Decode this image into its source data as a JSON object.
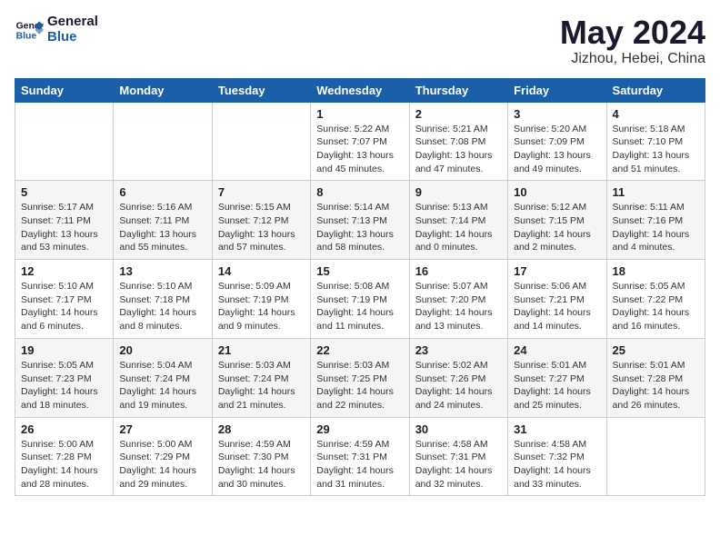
{
  "logo": {
    "line1": "General",
    "line2": "Blue"
  },
  "title": "May 2024",
  "location": "Jizhou, Hebei, China",
  "days_of_week": [
    "Sunday",
    "Monday",
    "Tuesday",
    "Wednesday",
    "Thursday",
    "Friday",
    "Saturday"
  ],
  "weeks": [
    [
      {
        "day": "",
        "info": []
      },
      {
        "day": "",
        "info": []
      },
      {
        "day": "",
        "info": []
      },
      {
        "day": "1",
        "info": [
          "Sunrise: 5:22 AM",
          "Sunset: 7:07 PM",
          "Daylight: 13 hours",
          "and 45 minutes."
        ]
      },
      {
        "day": "2",
        "info": [
          "Sunrise: 5:21 AM",
          "Sunset: 7:08 PM",
          "Daylight: 13 hours",
          "and 47 minutes."
        ]
      },
      {
        "day": "3",
        "info": [
          "Sunrise: 5:20 AM",
          "Sunset: 7:09 PM",
          "Daylight: 13 hours",
          "and 49 minutes."
        ]
      },
      {
        "day": "4",
        "info": [
          "Sunrise: 5:18 AM",
          "Sunset: 7:10 PM",
          "Daylight: 13 hours",
          "and 51 minutes."
        ]
      }
    ],
    [
      {
        "day": "5",
        "info": [
          "Sunrise: 5:17 AM",
          "Sunset: 7:11 PM",
          "Daylight: 13 hours",
          "and 53 minutes."
        ]
      },
      {
        "day": "6",
        "info": [
          "Sunrise: 5:16 AM",
          "Sunset: 7:11 PM",
          "Daylight: 13 hours",
          "and 55 minutes."
        ]
      },
      {
        "day": "7",
        "info": [
          "Sunrise: 5:15 AM",
          "Sunset: 7:12 PM",
          "Daylight: 13 hours",
          "and 57 minutes."
        ]
      },
      {
        "day": "8",
        "info": [
          "Sunrise: 5:14 AM",
          "Sunset: 7:13 PM",
          "Daylight: 13 hours",
          "and 58 minutes."
        ]
      },
      {
        "day": "9",
        "info": [
          "Sunrise: 5:13 AM",
          "Sunset: 7:14 PM",
          "Daylight: 14 hours",
          "and 0 minutes."
        ]
      },
      {
        "day": "10",
        "info": [
          "Sunrise: 5:12 AM",
          "Sunset: 7:15 PM",
          "Daylight: 14 hours",
          "and 2 minutes."
        ]
      },
      {
        "day": "11",
        "info": [
          "Sunrise: 5:11 AM",
          "Sunset: 7:16 PM",
          "Daylight: 14 hours",
          "and 4 minutes."
        ]
      }
    ],
    [
      {
        "day": "12",
        "info": [
          "Sunrise: 5:10 AM",
          "Sunset: 7:17 PM",
          "Daylight: 14 hours",
          "and 6 minutes."
        ]
      },
      {
        "day": "13",
        "info": [
          "Sunrise: 5:10 AM",
          "Sunset: 7:18 PM",
          "Daylight: 14 hours",
          "and 8 minutes."
        ]
      },
      {
        "day": "14",
        "info": [
          "Sunrise: 5:09 AM",
          "Sunset: 7:19 PM",
          "Daylight: 14 hours",
          "and 9 minutes."
        ]
      },
      {
        "day": "15",
        "info": [
          "Sunrise: 5:08 AM",
          "Sunset: 7:19 PM",
          "Daylight: 14 hours",
          "and 11 minutes."
        ]
      },
      {
        "day": "16",
        "info": [
          "Sunrise: 5:07 AM",
          "Sunset: 7:20 PM",
          "Daylight: 14 hours",
          "and 13 minutes."
        ]
      },
      {
        "day": "17",
        "info": [
          "Sunrise: 5:06 AM",
          "Sunset: 7:21 PM",
          "Daylight: 14 hours",
          "and 14 minutes."
        ]
      },
      {
        "day": "18",
        "info": [
          "Sunrise: 5:05 AM",
          "Sunset: 7:22 PM",
          "Daylight: 14 hours",
          "and 16 minutes."
        ]
      }
    ],
    [
      {
        "day": "19",
        "info": [
          "Sunrise: 5:05 AM",
          "Sunset: 7:23 PM",
          "Daylight: 14 hours",
          "and 18 minutes."
        ]
      },
      {
        "day": "20",
        "info": [
          "Sunrise: 5:04 AM",
          "Sunset: 7:24 PM",
          "Daylight: 14 hours",
          "and 19 minutes."
        ]
      },
      {
        "day": "21",
        "info": [
          "Sunrise: 5:03 AM",
          "Sunset: 7:24 PM",
          "Daylight: 14 hours",
          "and 21 minutes."
        ]
      },
      {
        "day": "22",
        "info": [
          "Sunrise: 5:03 AM",
          "Sunset: 7:25 PM",
          "Daylight: 14 hours",
          "and 22 minutes."
        ]
      },
      {
        "day": "23",
        "info": [
          "Sunrise: 5:02 AM",
          "Sunset: 7:26 PM",
          "Daylight: 14 hours",
          "and 24 minutes."
        ]
      },
      {
        "day": "24",
        "info": [
          "Sunrise: 5:01 AM",
          "Sunset: 7:27 PM",
          "Daylight: 14 hours",
          "and 25 minutes."
        ]
      },
      {
        "day": "25",
        "info": [
          "Sunrise: 5:01 AM",
          "Sunset: 7:28 PM",
          "Daylight: 14 hours",
          "and 26 minutes."
        ]
      }
    ],
    [
      {
        "day": "26",
        "info": [
          "Sunrise: 5:00 AM",
          "Sunset: 7:28 PM",
          "Daylight: 14 hours",
          "and 28 minutes."
        ]
      },
      {
        "day": "27",
        "info": [
          "Sunrise: 5:00 AM",
          "Sunset: 7:29 PM",
          "Daylight: 14 hours",
          "and 29 minutes."
        ]
      },
      {
        "day": "28",
        "info": [
          "Sunrise: 4:59 AM",
          "Sunset: 7:30 PM",
          "Daylight: 14 hours",
          "and 30 minutes."
        ]
      },
      {
        "day": "29",
        "info": [
          "Sunrise: 4:59 AM",
          "Sunset: 7:31 PM",
          "Daylight: 14 hours",
          "and 31 minutes."
        ]
      },
      {
        "day": "30",
        "info": [
          "Sunrise: 4:58 AM",
          "Sunset: 7:31 PM",
          "Daylight: 14 hours",
          "and 32 minutes."
        ]
      },
      {
        "day": "31",
        "info": [
          "Sunrise: 4:58 AM",
          "Sunset: 7:32 PM",
          "Daylight: 14 hours",
          "and 33 minutes."
        ]
      },
      {
        "day": "",
        "info": []
      }
    ]
  ]
}
